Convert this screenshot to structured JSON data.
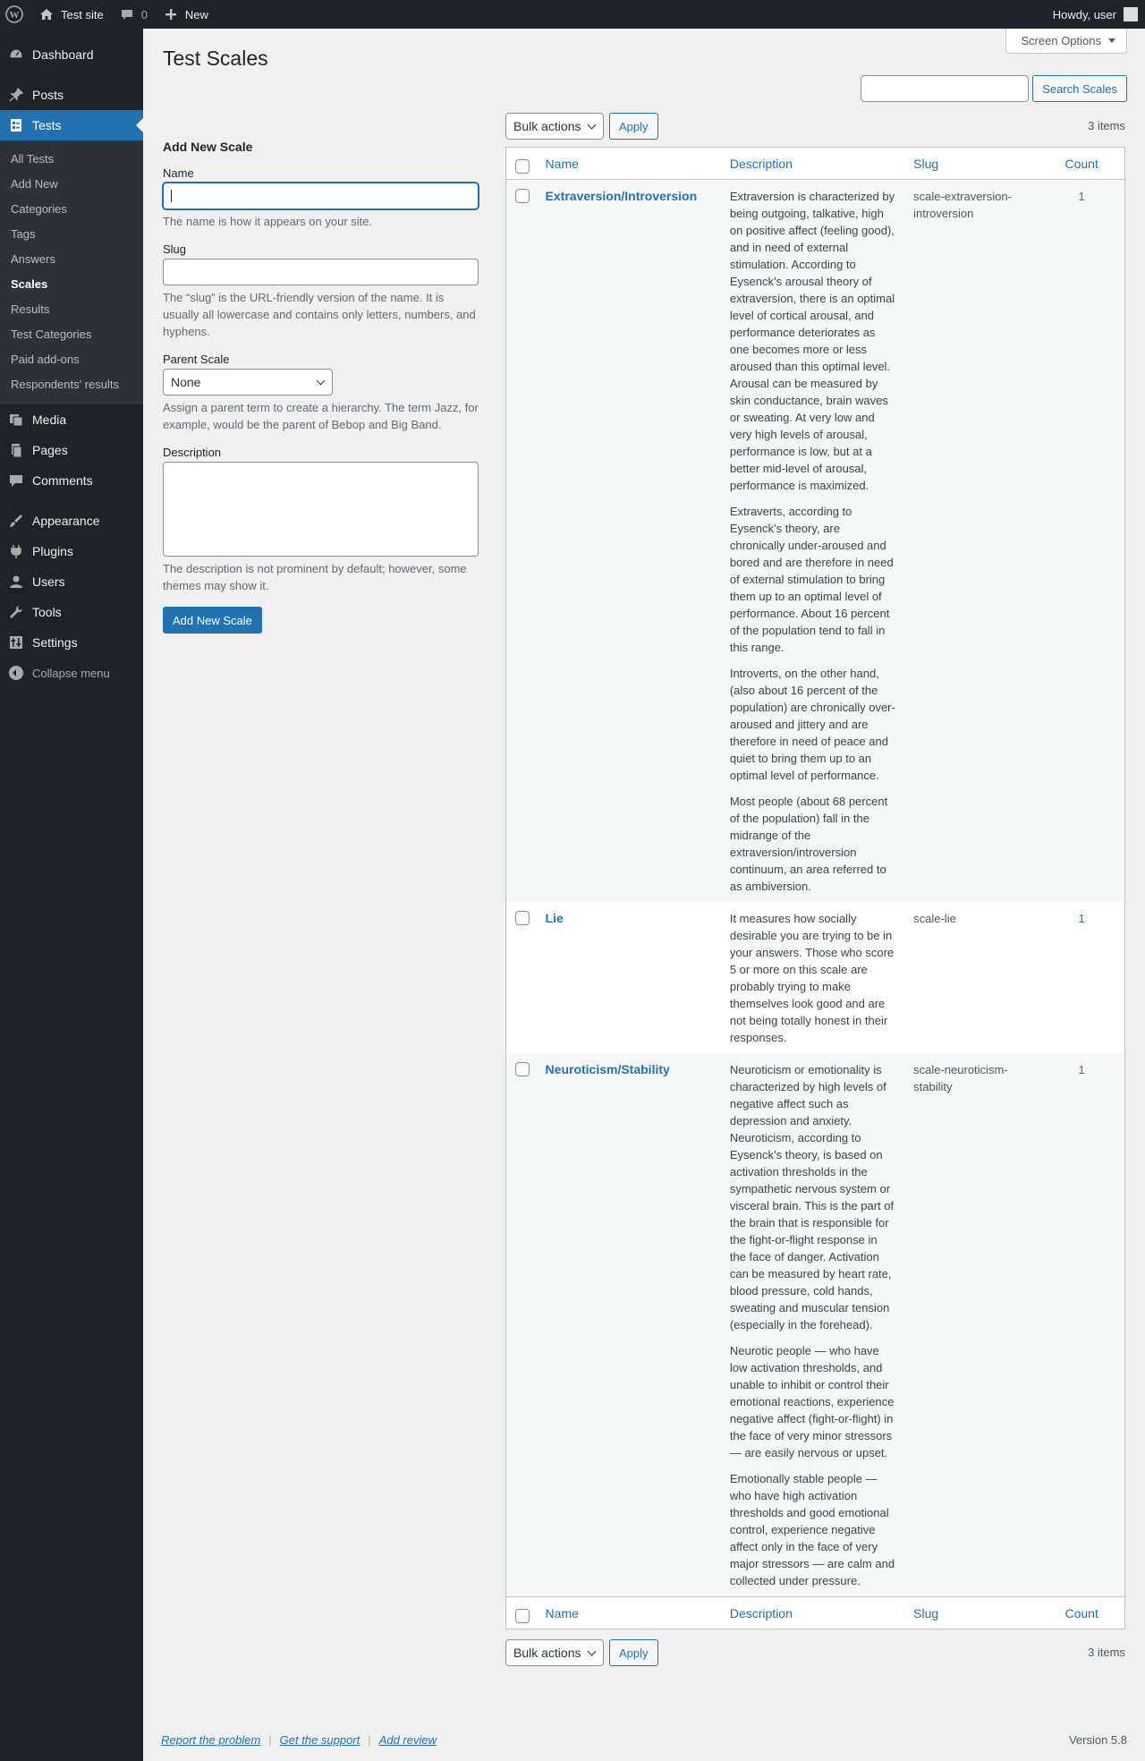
{
  "adminbar": {
    "site_name": "Test site",
    "comments_count": "0",
    "new_label": "New",
    "howdy": "Howdy, user"
  },
  "sidebar": {
    "items": [
      {
        "label": "Dashboard",
        "icon": "dashboard-icon"
      },
      {
        "label": "Posts",
        "icon": "pin-icon"
      },
      {
        "label": "Tests",
        "icon": "tests-icon"
      },
      {
        "label": "Media",
        "icon": "media-icon"
      },
      {
        "label": "Pages",
        "icon": "pages-icon"
      },
      {
        "label": "Comments",
        "icon": "comment-icon"
      },
      {
        "label": "Appearance",
        "icon": "brush-icon"
      },
      {
        "label": "Plugins",
        "icon": "plug-icon"
      },
      {
        "label": "Users",
        "icon": "user-icon"
      },
      {
        "label": "Tools",
        "icon": "wrench-icon"
      },
      {
        "label": "Settings",
        "icon": "settings-icon"
      }
    ],
    "submenu": [
      "All Tests",
      "Add New",
      "Categories",
      "Tags",
      "Answers",
      "Scales",
      "Results",
      "Test Categories",
      "Paid add-ons",
      "Respondents' results"
    ],
    "collapse": "Collapse menu"
  },
  "page": {
    "title": "Test Scales",
    "screen_options": "Screen Options",
    "search_button": "Search Scales"
  },
  "form": {
    "heading": "Add New Scale",
    "name_label": "Name",
    "name_help": "The name is how it appears on your site.",
    "slug_label": "Slug",
    "slug_help": "The “slug” is the URL-friendly version of the name. It is usually all lowercase and contains only letters, numbers, and hyphens.",
    "parent_label": "Parent Scale",
    "parent_value": "None",
    "parent_help": "Assign a parent term to create a hierarchy. The term Jazz, for example, would be the parent of Bebop and Big Band.",
    "description_label": "Description",
    "description_help": "The description is not prominent by default; however, some themes may show it.",
    "submit": "Add New Scale"
  },
  "table": {
    "bulk_actions": "Bulk actions",
    "apply": "Apply",
    "items_count": "3 items",
    "columns": {
      "name": "Name",
      "description": "Description",
      "slug": "Slug",
      "count": "Count"
    },
    "rows": [
      {
        "name": "Extraversion/Introversion",
        "slug": "scale-extraversion-introversion",
        "count": "1",
        "description": [
          "Extraversion is characterized by being outgoing, talkative, high on positive affect (feeling good), and in need of external stimulation. According to Eysenck’s arousal theory of extraversion, there is an optimal level of cortical arousal, and performance deteriorates as one becomes more or less aroused than this optimal level. Arousal can be measured by skin conductance, brain waves or sweating. At very low and very high levels of arousal, performance is low, but at a better mid-level of arousal, performance is maximized.",
          "Extraverts, according to Eysenck’s theory, are chronically under-aroused and bored and are therefore in need of external stimulation to bring them up to an optimal level of performance. About 16 percent of the population tend to fall in this range.",
          "Introverts, on the other hand, (also about 16 percent of the population) are chronically over-aroused and jittery and are therefore in need of peace and quiet to bring them up to an optimal level of performance.",
          "Most people (about 68 percent of the population) fall in the midrange of the extraversion/introversion continuum, an area referred to as ambiversion."
        ]
      },
      {
        "name": "Lie",
        "slug": "scale-lie",
        "count": "1",
        "description": [
          "It measures how socially desirable you are trying to be in your answers. Those who score 5 or more on this scale are probably trying to make themselves look good and are not being totally honest in their responses."
        ]
      },
      {
        "name": "Neuroticism/Stability",
        "slug": "scale-neuroticism-stability",
        "count": "1",
        "description": [
          "Neuroticism or emotionality is characterized by high levels of negative affect such as depression and anxiety. Neuroticism, according to Eysenck’s theory, is based on activation thresholds in the sympathetic nervous system or visceral brain. This is the part of the brain that is responsible for the fight-or-flight response in the face of danger. Activation can be measured by heart rate, blood pressure, cold hands, sweating and muscular tension (especially in the forehead).",
          "Neurotic people — who have low activation thresholds, and unable to inhibit or control their emotional reactions, experience negative affect (fight-or-flight) in the face of very minor stressors — are easily nervous or upset.",
          "Emotionally stable people — who have high activation thresholds and good emotional control, experience negative affect only in the face of very major stressors — are calm and collected under pressure."
        ]
      }
    ]
  },
  "footer": {
    "report": "Report the problem",
    "support": "Get the support",
    "review": "Add review",
    "version": "Version 5.8"
  }
}
